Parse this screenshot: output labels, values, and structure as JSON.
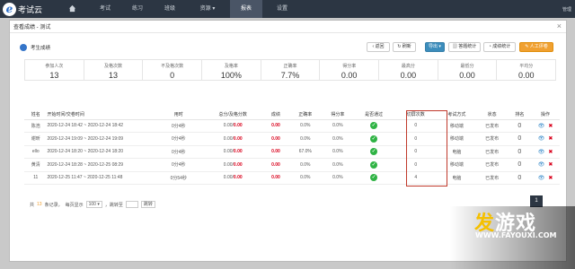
{
  "nav": {
    "brand": "考试云",
    "items": [
      "考试",
      "练习",
      "班级",
      "资源",
      "报表",
      "设置"
    ],
    "active": "报表",
    "user": "管理"
  },
  "modal": {
    "title": "查看成绩 - 测试",
    "close": "×"
  },
  "panel": {
    "title": "考生成绩",
    "buttons": {
      "back": "‹ 返回",
      "refresh": "↻ 刷新",
      "export": "导出",
      "stats1": "答题统计",
      "stats2": "成绩统计",
      "manual": "人工评卷"
    }
  },
  "stats": [
    {
      "label": "参加人次",
      "value": "13"
    },
    {
      "label": "及格次数",
      "value": "13"
    },
    {
      "label": "不及格次数",
      "value": "0"
    },
    {
      "label": "及格率",
      "value": "100%"
    },
    {
      "label": "正确率",
      "value": "7.7%"
    },
    {
      "label": "得分率",
      "value": "0.00"
    },
    {
      "label": "最高分",
      "value": "0.00"
    },
    {
      "label": "最低分",
      "value": "0.00"
    },
    {
      "label": "平均分",
      "value": "0.00"
    }
  ],
  "table": {
    "headers": [
      "姓名",
      "开始时间/交卷时间",
      "用时",
      "总分/及格分数",
      "成绩",
      "正确率",
      "得分率",
      "是否通过",
      "切屏次数",
      "考试方式",
      "状态",
      "排名",
      "操作"
    ],
    "rows": [
      {
        "name": "陈浩",
        "time": "2020-12-24 18:42 ~ 2020-12-24 18:42",
        "dur": "0分4秒",
        "total": "0.00/",
        "score_red": "0.00",
        "score": "0.00",
        "acc": "0.0%",
        "rate": "0.0%",
        "switch": "0",
        "mode": "移动端",
        "status": "已发布",
        "rank": "0"
      },
      {
        "name": "谢昕",
        "time": "2020-12-24 19:09 ~ 2020-12-24 19:09",
        "dur": "0分4秒",
        "total": "0.00/",
        "score_red": "0.00",
        "score": "0.00",
        "acc": "0.0%",
        "rate": "0.0%",
        "switch": "0",
        "mode": "移动端",
        "status": "已发布",
        "rank": "0"
      },
      {
        "name": "ello",
        "time": "2020-12-24 18:20 ~ 2020-12-24 18:20",
        "dur": "0分4秒",
        "total": "0.00/",
        "score_red": "0.00",
        "score": "0.00",
        "acc": "67.0%",
        "rate": "0.0%",
        "switch": "0",
        "mode": "电脑",
        "status": "已发布",
        "rank": "0"
      },
      {
        "name": "黄清",
        "time": "2020-12-24 18:28 ~ 2020-12-25 08:29",
        "dur": "0分4秒",
        "total": "0.00/",
        "score_red": "0.00",
        "score": "0.00",
        "acc": "0.0%",
        "rate": "0.0%",
        "switch": "0",
        "mode": "移动端",
        "status": "已发布",
        "rank": "0"
      },
      {
        "name": "11",
        "time": "2020-12-25 11:47 ~ 2020-12-25 11:48",
        "dur": "0分54秒",
        "total": "0.00/",
        "score_red": "0.00",
        "score": "0.00",
        "acc": "0.0%",
        "rate": "0.0%",
        "switch": "4",
        "mode": "电脑",
        "status": "已发布",
        "rank": "0"
      }
    ]
  },
  "pager": {
    "total_prefix": "共",
    "total": "13",
    "total_suffix": "条记录，",
    "per_label": "每页显示",
    "per_value": "100 ▾",
    "jump_label": "，跳转至",
    "go": "跳转",
    "page": "1"
  },
  "watermark": {
    "brand_a": "发",
    "brand_b": "游戏",
    "url": "WWW.FAYOUXI.COM"
  }
}
